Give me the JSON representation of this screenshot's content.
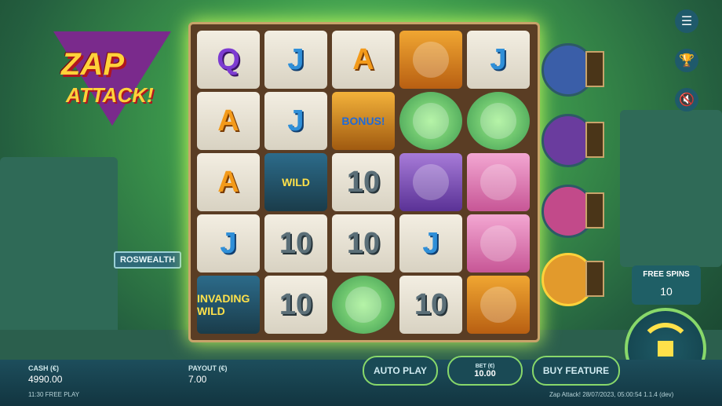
{
  "logo": {
    "line1": "ZAP",
    "line2": "ATTACK!"
  },
  "town_sign": "ROSWEALTH",
  "reels": [
    [
      {
        "type": "card",
        "text": "Q",
        "cls": "q"
      },
      {
        "type": "card",
        "text": "A",
        "cls": "a"
      },
      {
        "type": "card",
        "text": "A",
        "cls": "a"
      },
      {
        "type": "card",
        "text": "J",
        "cls": "j"
      },
      {
        "type": "wild-invading",
        "text": "INVADING WILD",
        "cls": ""
      }
    ],
    [
      {
        "type": "card",
        "text": "J",
        "cls": "j"
      },
      {
        "type": "card",
        "text": "J",
        "cls": "j"
      },
      {
        "type": "wild",
        "text": "WILD",
        "cls": ""
      },
      {
        "type": "card",
        "text": "10",
        "cls": "ten"
      },
      {
        "type": "card",
        "text": "10",
        "cls": "ten"
      }
    ],
    [
      {
        "type": "card",
        "text": "A",
        "cls": "a"
      },
      {
        "type": "bonus",
        "text": "BONUS!",
        "cls": ""
      },
      {
        "type": "card",
        "text": "10",
        "cls": "ten"
      },
      {
        "type": "card",
        "text": "10",
        "cls": "ten"
      },
      {
        "type": "alien",
        "text": "",
        "cls": ""
      }
    ],
    [
      {
        "type": "sheriff",
        "text": "",
        "cls": ""
      },
      {
        "type": "alien",
        "text": "",
        "cls": ""
      },
      {
        "type": "granny",
        "text": "",
        "cls": ""
      },
      {
        "type": "card",
        "text": "J",
        "cls": "j"
      },
      {
        "type": "card",
        "text": "10",
        "cls": "ten"
      }
    ],
    [
      {
        "type": "card",
        "text": "J",
        "cls": "j"
      },
      {
        "type": "alien",
        "text": "",
        "cls": ""
      },
      {
        "type": "girl",
        "text": "",
        "cls": ""
      },
      {
        "type": "girl",
        "text": "",
        "cls": ""
      },
      {
        "type": "sheriff",
        "text": "",
        "cls": ""
      }
    ]
  ],
  "side_symbols": [
    "cop",
    "granny",
    "girl",
    "sheriff"
  ],
  "menu_icons": [
    "menu-icon",
    "trophy-icon",
    "sound-off-icon"
  ],
  "free_spins": {
    "label": "FREE SPINS",
    "value": "10"
  },
  "cash": {
    "label": "CASH (€)",
    "value": "4990.00"
  },
  "payout": {
    "label": "PAYOUT (€)",
    "value": "7.00"
  },
  "bet": {
    "label": "BET (€)",
    "value": "10.00"
  },
  "buttons": {
    "auto_play": "AUTO PLAY",
    "buy_feature": "BUY FEATURE"
  },
  "status": {
    "left": "11:30  FREE PLAY",
    "right": "Zap Attack!  28/07/2023, 05:00:54  1.1.4 (dev)"
  },
  "colors": {
    "accent": "#88d86a",
    "panel": "#1a4a55",
    "gold": "#ffd23a"
  }
}
